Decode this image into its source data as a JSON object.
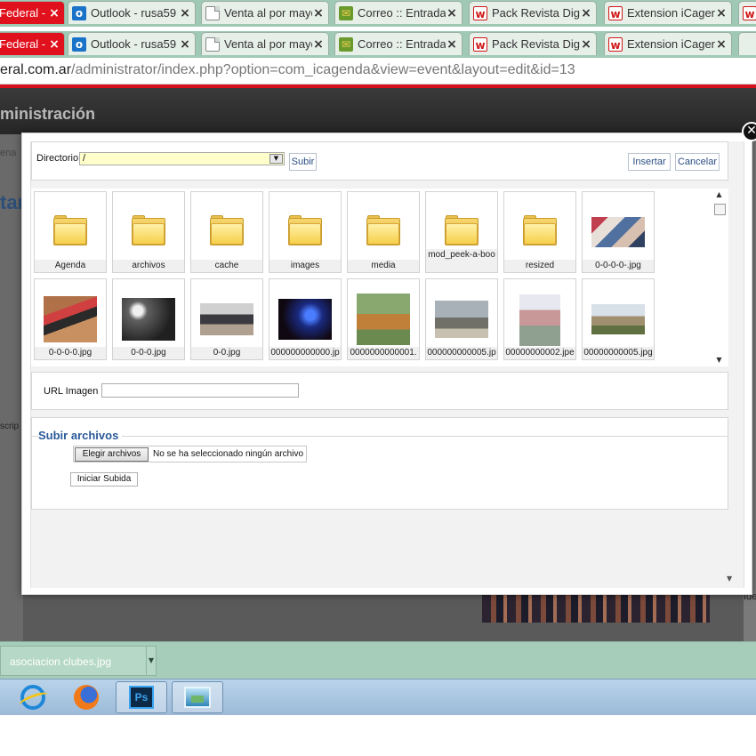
{
  "browser": {
    "tabs": [
      {
        "title": "Federal -",
        "icon": "w-logo-icon",
        "active": true
      },
      {
        "title": "Outlook - rusa59",
        "icon": "outlook-icon",
        "active": false
      },
      {
        "title": "Venta al por mayo",
        "icon": "document-icon",
        "active": false
      },
      {
        "title": "Correo :: Entrada",
        "icon": "mail-icon",
        "active": false
      },
      {
        "title": "Pack Revista Digit",
        "icon": "w-logo-icon",
        "active": false
      },
      {
        "title": "Extension iCagend",
        "icon": "w-logo-icon",
        "active": false
      }
    ],
    "close_glyph": "×",
    "address": {
      "domain": "eral.com.ar",
      "path": "/administrator/index.php?option=com_icagenda&view=event&layout=edit&id=13"
    }
  },
  "admin": {
    "header_title": "ministración",
    "frag_left_title": "tar",
    "frag_left_small": "ena",
    "frag_descrip": "scrip",
    "frag_right": "Ide"
  },
  "modal": {
    "close_glyph": "✕",
    "directory_label": "Directorio",
    "directory_value": "/",
    "upload_button": "Subir",
    "insert_button": "Insertar",
    "cancel_button": "Cancelar",
    "items": [
      {
        "name": "Agenda",
        "kind": "folder"
      },
      {
        "name": "archivos",
        "kind": "folder"
      },
      {
        "name": "cache",
        "kind": "folder"
      },
      {
        "name": "images",
        "kind": "folder"
      },
      {
        "name": "media",
        "kind": "folder"
      },
      {
        "name": "mod_peek-a-boo",
        "kind": "folder"
      },
      {
        "name": "resized",
        "kind": "folder"
      },
      {
        "name": "0-0-0-0-.jpg",
        "kind": "image"
      },
      {
        "name": "0-0-0-0.jpg",
        "kind": "image"
      },
      {
        "name": "0-0-0.jpg",
        "kind": "image"
      },
      {
        "name": "0-0.jpg",
        "kind": "image"
      },
      {
        "name": "000000000000.jp",
        "kind": "image"
      },
      {
        "name": "0000000000001.",
        "kind": "image"
      },
      {
        "name": "000000000005.jp",
        "kind": "image"
      },
      {
        "name": "00000000002.jpe",
        "kind": "image"
      },
      {
        "name": "00000000005.jpg",
        "kind": "image"
      }
    ],
    "url_label": "URL Imagen",
    "url_value": "",
    "upload_section_title": "Subir archivos",
    "choose_files_button": "Elegir archivos",
    "no_file_text": "No se ha seleccionado ningún archivo",
    "start_upload_button": "Iniciar Subida"
  },
  "download_bar": {
    "file_name": "asociacion clubes.jpg"
  },
  "taskbar": {
    "apps": [
      {
        "name": "internet-explorer-icon",
        "active": false
      },
      {
        "name": "firefox-icon",
        "active": false
      },
      {
        "name": "photoshop-icon",
        "active": true,
        "label": "Ps"
      },
      {
        "name": "picture-viewer-icon",
        "active": true
      }
    ]
  },
  "colors": {
    "accent_red": "#e0101c",
    "tab_bg": "#9fc9b5",
    "link_blue": "#2a5a9a",
    "selector_yellow": "#ffffcc"
  }
}
